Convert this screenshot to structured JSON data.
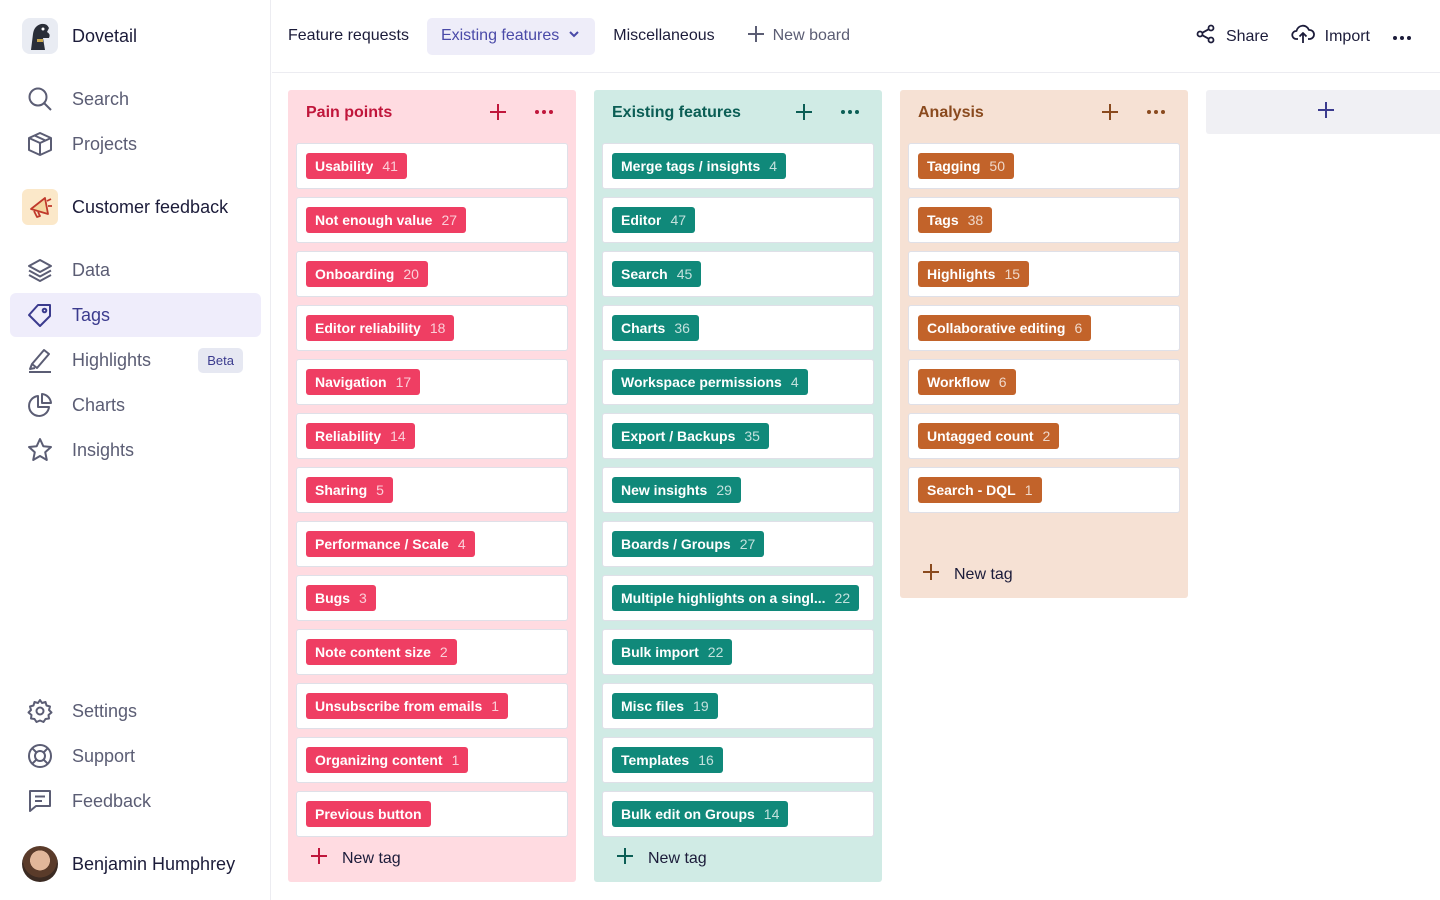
{
  "app": {
    "name": "Dovetail"
  },
  "sidebar": {
    "search": "Search",
    "projects": "Projects",
    "project_name": "Customer feedback",
    "data": "Data",
    "tags": "Tags",
    "highlights": "Highlights",
    "beta": "Beta",
    "charts": "Charts",
    "insights": "Insights",
    "settings": "Settings",
    "support": "Support",
    "feedback": "Feedback",
    "user_name": "Benjamin Humphrey"
  },
  "topbar": {
    "tabs": [
      "Feature requests",
      "Existing features",
      "Miscellaneous"
    ],
    "active_tab": "Existing features",
    "new_board": "New board",
    "share": "Share",
    "import": "Import"
  },
  "colors": {
    "pain": "#ef3e63",
    "existing": "#10897a",
    "analysis": "#c2632a"
  },
  "columns": [
    {
      "title": "Pain points",
      "new_tag": "New tag",
      "tags": [
        {
          "name": "Usability",
          "count": "41"
        },
        {
          "name": "Not enough value",
          "count": "27"
        },
        {
          "name": "Onboarding",
          "count": "20"
        },
        {
          "name": "Editor reliability",
          "count": "18"
        },
        {
          "name": "Navigation",
          "count": "17"
        },
        {
          "name": "Reliability",
          "count": "14"
        },
        {
          "name": "Sharing",
          "count": "5"
        },
        {
          "name": "Performance / Scale",
          "count": "4"
        },
        {
          "name": "Bugs",
          "count": "3"
        },
        {
          "name": "Note content size",
          "count": "2"
        },
        {
          "name": "Unsubscribe from emails",
          "count": "1"
        },
        {
          "name": "Organizing content",
          "count": "1"
        },
        {
          "name": "Previous button",
          "count": ""
        }
      ]
    },
    {
      "title": "Existing features",
      "new_tag": "New tag",
      "tags": [
        {
          "name": "Merge tags / insights",
          "count": "4"
        },
        {
          "name": "Editor",
          "count": "47"
        },
        {
          "name": "Search",
          "count": "45"
        },
        {
          "name": "Charts",
          "count": "36"
        },
        {
          "name": "Workspace permissions",
          "count": "4"
        },
        {
          "name": "Export / Backups",
          "count": "35"
        },
        {
          "name": "New insights",
          "count": "29"
        },
        {
          "name": "Boards / Groups",
          "count": "27"
        },
        {
          "name": "Multiple highlights on a singl...",
          "count": "22"
        },
        {
          "name": "Bulk import",
          "count": "22"
        },
        {
          "name": "Misc files",
          "count": "19"
        },
        {
          "name": "Templates",
          "count": "16"
        },
        {
          "name": "Bulk edit on Groups",
          "count": "14"
        }
      ]
    },
    {
      "title": "Analysis",
      "new_tag": "New tag",
      "tags": [
        {
          "name": "Tagging",
          "count": "50"
        },
        {
          "name": "Tags",
          "count": "38"
        },
        {
          "name": "Highlights",
          "count": "15"
        },
        {
          "name": "Collaborative editing",
          "count": "6"
        },
        {
          "name": "Workflow",
          "count": "6"
        },
        {
          "name": "Untagged count",
          "count": "2"
        },
        {
          "name": "Search - DQL",
          "count": "1"
        }
      ]
    }
  ]
}
